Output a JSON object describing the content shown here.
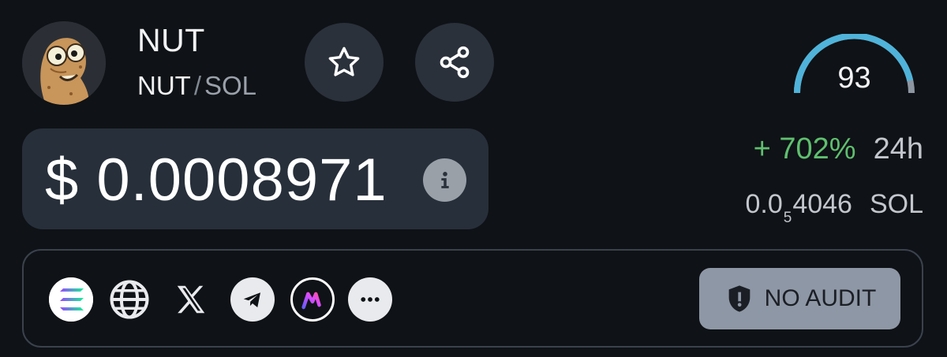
{
  "token": {
    "name": "NUT",
    "base": "NUT",
    "separator": "/",
    "quote": "SOL",
    "avatar_icon": "peanut-mascot-icon"
  },
  "actions": {
    "favorite_icon": "star-icon",
    "share_icon": "share-icon"
  },
  "score": {
    "value": "93",
    "fill_fraction": 0.93,
    "color": "#4fb3da"
  },
  "price": {
    "usd": "$ 0.0008971",
    "info_icon": "info-icon"
  },
  "change": {
    "value": "+ 702%",
    "period": "24h",
    "color": "#5fbf6f"
  },
  "sol_price": {
    "prefix": "0.0",
    "zeros_sub": "5",
    "digits": "4046",
    "unit": "SOL"
  },
  "links": [
    {
      "name": "solana-icon"
    },
    {
      "name": "website-globe-icon"
    },
    {
      "name": "x-twitter-icon"
    },
    {
      "name": "telegram-icon"
    },
    {
      "name": "moonshot-icon"
    },
    {
      "name": "more-icon"
    }
  ],
  "audit": {
    "label": "NO AUDIT",
    "icon": "shield-warning-icon"
  }
}
